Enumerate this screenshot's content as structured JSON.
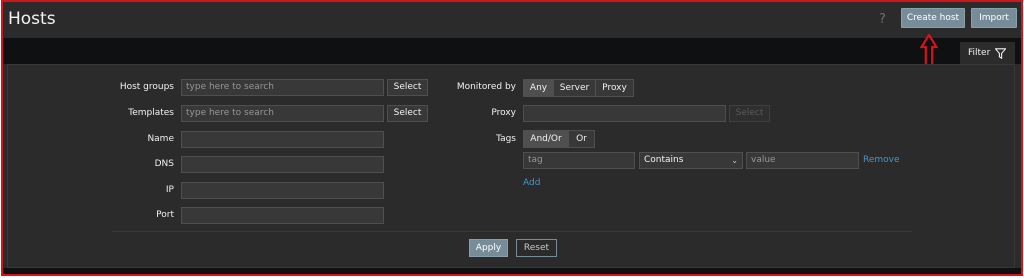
{
  "header": {
    "title": "Hosts",
    "help": "?",
    "create_host": "Create host",
    "import": "Import"
  },
  "filter_tab": {
    "label": "Filter",
    "icon": "funnel-icon"
  },
  "filter": {
    "host_groups": {
      "label": "Host groups",
      "placeholder": "type here to search",
      "select": "Select"
    },
    "templates": {
      "label": "Templates",
      "placeholder": "type here to search",
      "select": "Select"
    },
    "name": {
      "label": "Name",
      "value": ""
    },
    "dns": {
      "label": "DNS",
      "value": ""
    },
    "ip": {
      "label": "IP",
      "value": ""
    },
    "port": {
      "label": "Port",
      "value": ""
    },
    "monitored_by": {
      "label": "Monitored by",
      "options": [
        "Any",
        "Server",
        "Proxy"
      ],
      "selected": "Any"
    },
    "proxy": {
      "label": "Proxy",
      "value": "",
      "select": "Select"
    },
    "tags": {
      "label": "Tags",
      "operators": [
        "And/Or",
        "Or"
      ],
      "selected": "And/Or",
      "tag_placeholder": "tag",
      "condition": "Contains",
      "value_placeholder": "value",
      "remove": "Remove",
      "add": "Add"
    },
    "apply": "Apply",
    "reset": "Reset"
  },
  "colors": {
    "annotation": "#d4141c",
    "primary_button": "#768d99",
    "link": "#4796c4"
  }
}
